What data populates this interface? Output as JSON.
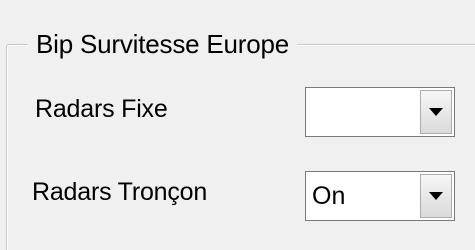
{
  "group": {
    "title": "Bip Survitesse Europe"
  },
  "fields": [
    {
      "label": "Radars Fixe",
      "value": ""
    },
    {
      "label": "Radars Tronçon",
      "value": "On"
    }
  ],
  "icons": {
    "dropdown": "chevron-down-icon"
  },
  "colors": {
    "background": "#f0f0f0",
    "combo_border": "#7a7a7a",
    "groupbox_border": "#c9c9c9"
  }
}
